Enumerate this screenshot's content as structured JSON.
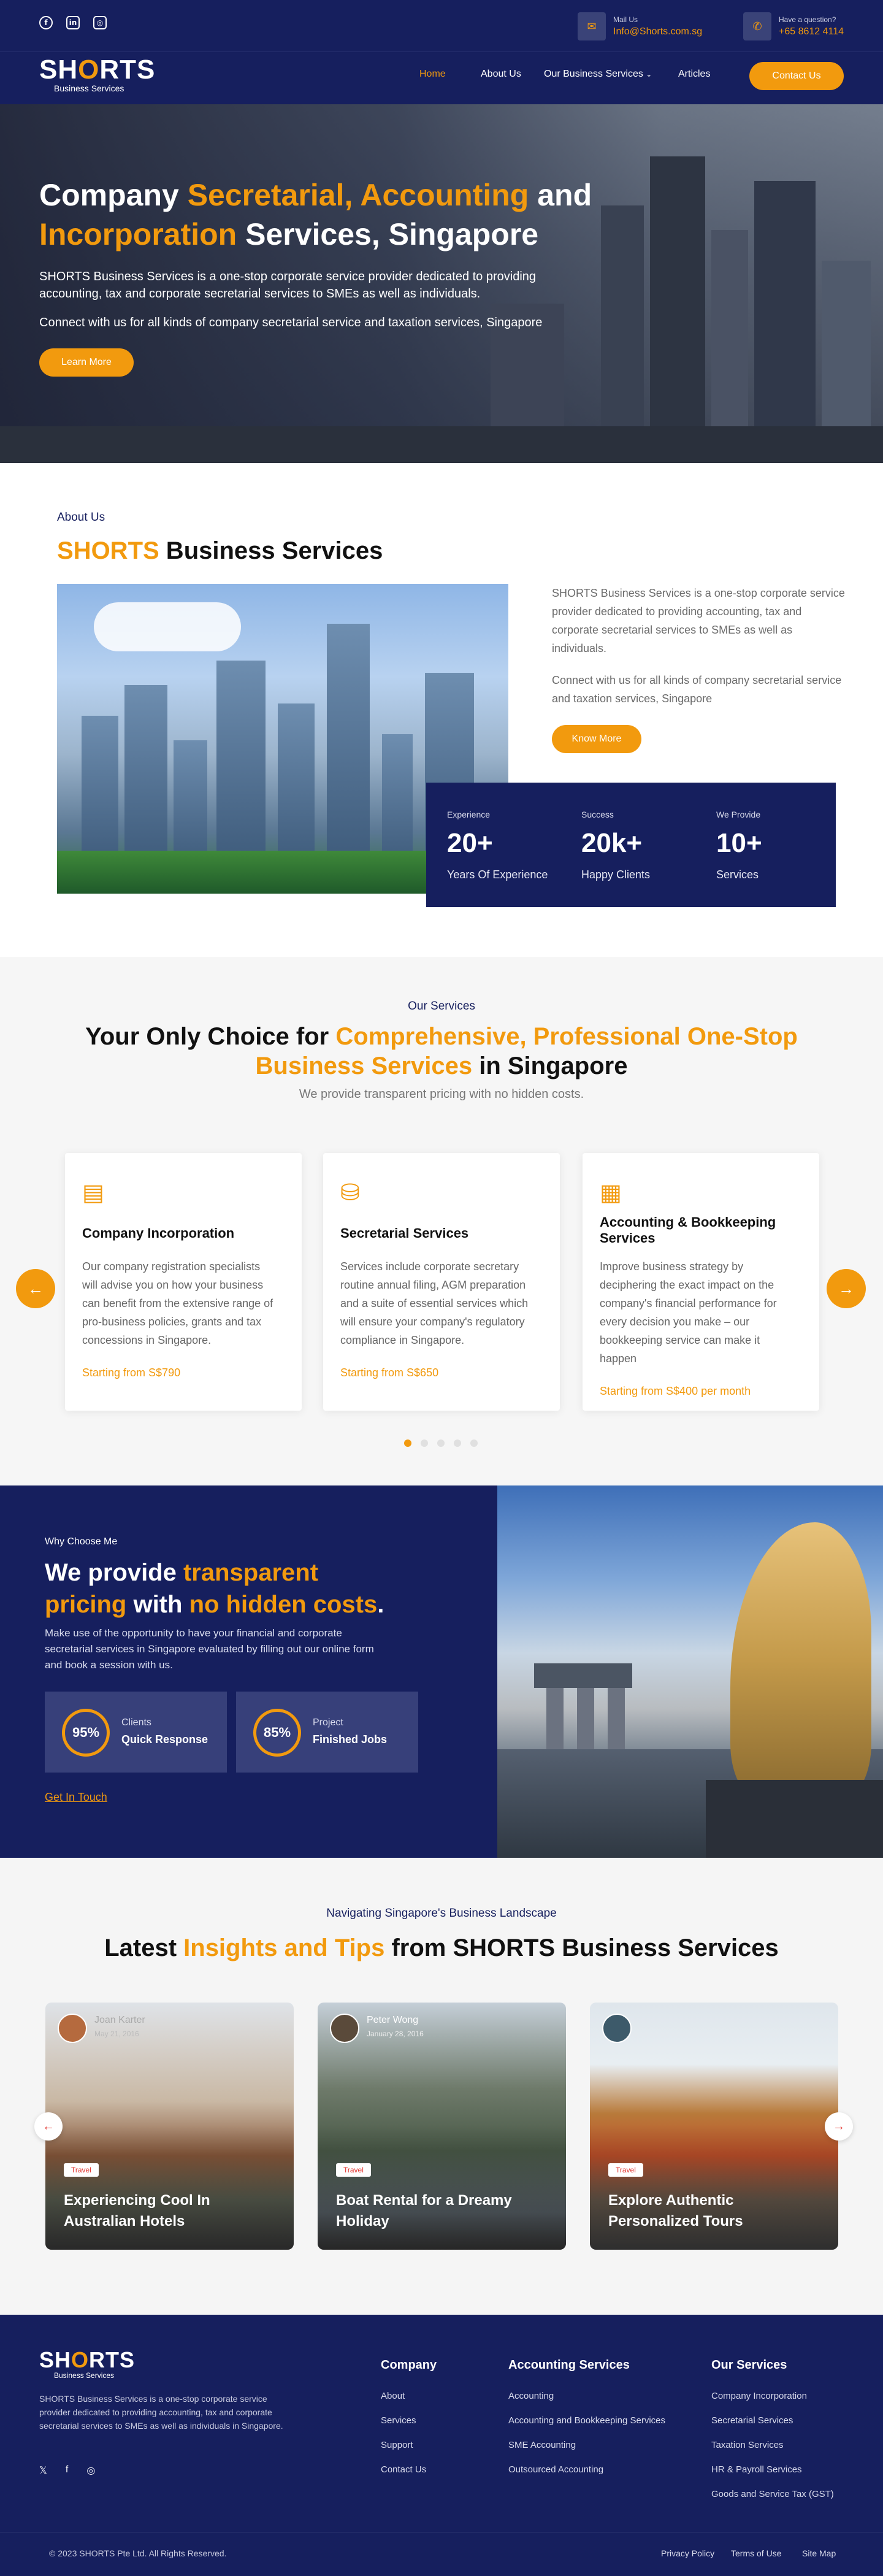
{
  "header": {
    "mail_label": "Mail Us",
    "mail_value": "Info@Shorts.com.sg",
    "phone_label": "Have a question?",
    "phone_value": "+65 8612 4114",
    "social": [
      "facebook-icon",
      "linkedin-icon",
      "instagram-icon"
    ]
  },
  "brand": {
    "name": "SHORTS",
    "subtitle": "Business Services"
  },
  "nav": {
    "home": "Home",
    "about": "About Us",
    "services": "Our Business Services",
    "articles": "Articles",
    "contact": "Contact Us"
  },
  "hero": {
    "title_1": "Company ",
    "title_highlight": "Secretarial, Accounting",
    "title_2": " and",
    "title_highlight_2": "Incorporation",
    "title_3": " Services, Singapore",
    "para_1": "SHORTS Business Services is a one-stop corporate service provider dedicated to providing accounting, tax and corporate secretarial services to SMEs as well as individuals.",
    "para_2": "Connect with us for all kinds of company secretarial service and taxation services, Singapore",
    "cta": "Learn More"
  },
  "about": {
    "kicker": "About Us",
    "title_brand": "SHORTS",
    "title_rest": " Business Services",
    "para_1": "SHORTS Business Services is a one-stop corporate service provider dedicated to providing accounting, tax and corporate secretarial services to SMEs as well as individuals.",
    "para_2": "Connect with us for all kinds of company secretarial service and taxation services, Singapore",
    "cta": "Know More",
    "stats": [
      {
        "kicker": "Experience",
        "value": "20+",
        "label": "Years Of Experience"
      },
      {
        "kicker": "Success",
        "value": "20k+",
        "label": "Happy Clients"
      },
      {
        "kicker": "We Provide",
        "value": "10+",
        "label": "Services"
      }
    ]
  },
  "services": {
    "kicker": "Our Services",
    "title_1": "Your Only Choice for ",
    "title_highlight": "Comprehensive, Professional One-Stop",
    "title_highlight_2": "Business Services",
    "title_2": " in Singapore",
    "subtitle": "We provide transparent pricing with no hidden costs.",
    "cards": [
      {
        "icon": "building-icon",
        "title": "Company Incorporation",
        "desc": "Our company registration specialists will advise you on how your business can benefit from the extensive range of pro-business policies, grants and tax concessions in Singapore.",
        "price": "Starting from S$790"
      },
      {
        "icon": "briefcase-icon",
        "title": "Secretarial Services",
        "desc": "Services include corporate secretary routine annual filing, AGM preparation and a suite of essential services which will ensure your company's regulatory compliance in Singapore.",
        "price": "Starting from S$650"
      },
      {
        "icon": "ledger-icon",
        "title": "Accounting & Bookkeeping Services",
        "desc": "Improve business strategy by deciphering the exact impact on the company's financial performance for every decision you make – our bookkeeping service can make it happen",
        "price": "Starting from S$400 per month"
      }
    ]
  },
  "why": {
    "kicker": "Why Choose Me",
    "title_1": "We provide ",
    "title_highlight": "transparent",
    "title_highlight_2": "pricing",
    "title_2": " with ",
    "title_highlight_3": "no hidden costs",
    "title_3": ".",
    "para": "Make use of the opportunity to have your financial and corporate secretarial services in Singapore evaluated by filling out our online form and book a session with us.",
    "boxes": [
      {
        "percent": "95%",
        "percent_value": 95,
        "label": "Clients",
        "value": "Quick Response"
      },
      {
        "percent": "85%",
        "percent_value": 85,
        "label": "Project",
        "value": "Finished Jobs"
      }
    ],
    "cta": "Get In Touch"
  },
  "insights": {
    "kicker": "Navigating Singapore's Business Landscape",
    "title_1": "Latest ",
    "title_highlight": "Insights and Tips",
    "title_2": " from SHORTS Business Services",
    "posts": [
      {
        "author": "Joan Karter",
        "date": "May 21, 2016",
        "tag": "Travel",
        "title": "Experiencing Cool In Australian Hotels"
      },
      {
        "author": "Peter Wong",
        "date": "January 28, 2016",
        "tag": "Travel",
        "title": "Boat Rental for a Dreamy Holiday"
      },
      {
        "author": "",
        "date": "",
        "tag": "Travel",
        "title": "Explore Authentic Personalized Tours"
      }
    ]
  },
  "footer": {
    "about": "SHORTS Business Services is a one-stop corporate service provider dedicated to providing accounting, tax and corporate secretarial services to SMEs as well as individuals in Singapore.",
    "col_company": {
      "title": "Company",
      "links": [
        "About",
        "Services",
        "Support",
        "Contact Us"
      ]
    },
    "col_accounting": {
      "title": "Accounting Services",
      "links": [
        "Accounting",
        "Accounting and Bookkeeping Services",
        "SME Accounting",
        "Outsourced Accounting"
      ]
    },
    "col_services": {
      "title": "Our Services",
      "links": [
        "Company Incorporation",
        "Secretarial Services",
        "Taxation Services",
        "HR & Payroll Services",
        "Goods and Service Tax (GST)"
      ]
    },
    "copyright": "© 2023 SHORTS Pte Ltd. All Rights Reserved.",
    "legal": [
      "Privacy Policy",
      "Terms of Use",
      "Site Map"
    ]
  },
  "colors": {
    "navy": "#161f5e",
    "accent": "#f29a0e"
  }
}
